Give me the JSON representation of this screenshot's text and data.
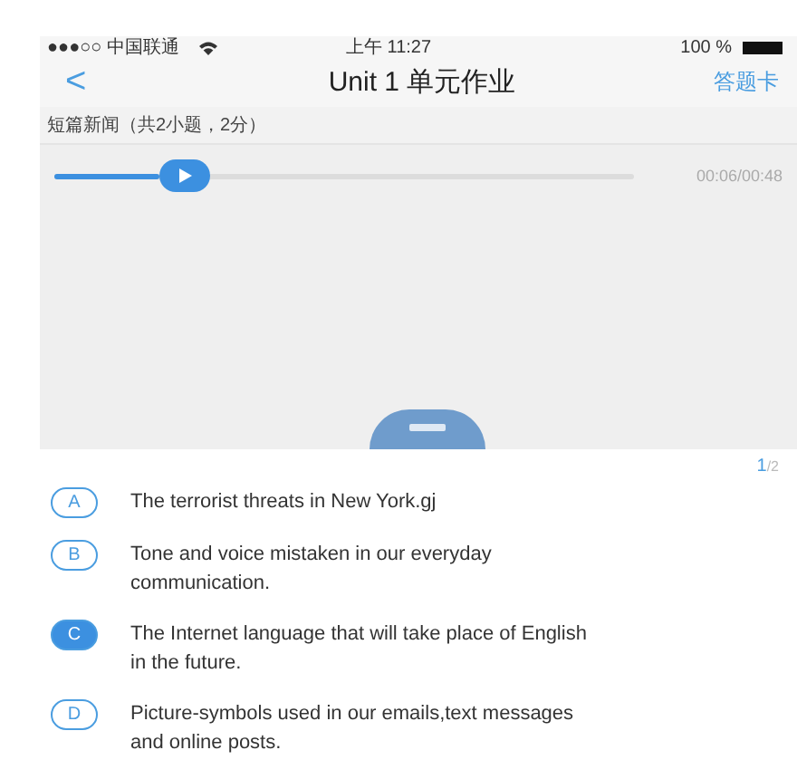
{
  "status_bar": {
    "carrier": "●●●○○ 中国联通",
    "time": "上午 11:27",
    "battery": "100 %"
  },
  "nav": {
    "back": "<",
    "title": "Unit 1 单元作业",
    "action": "答题卡"
  },
  "section": {
    "title": "短篇新闻（共2小题，2分）"
  },
  "player": {
    "level": 0.2,
    "time": "00:06/00:48"
  },
  "page_counter": {
    "current": "1",
    "total": "/2"
  },
  "options": [
    {
      "letter": "A",
      "text": "The terrorist threats in New York.gj",
      "selected": false
    },
    {
      "letter": "B",
      "text": "Tone and voice mistaken in our everyday communication.",
      "selected": false
    },
    {
      "letter": "C",
      "text": "The Internet language that will take place of English in the future.",
      "selected": true
    },
    {
      "letter": "D",
      "text": "Picture-symbols used in our emails,text messages and online posts.",
      "selected": false
    }
  ]
}
